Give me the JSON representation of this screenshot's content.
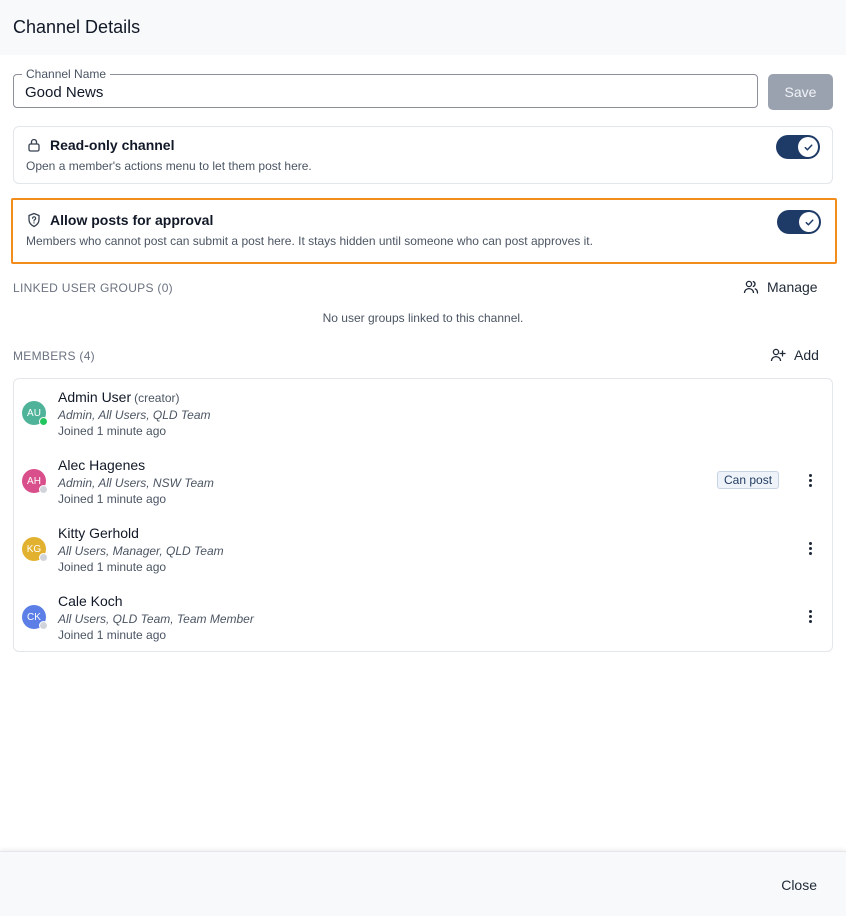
{
  "dialog": {
    "title": "Channel Details"
  },
  "channel_name": {
    "label": "Channel Name",
    "value": "Good News"
  },
  "save_button": {
    "label": "Save"
  },
  "read_only": {
    "title": "Read-only channel",
    "description": "Open a member's actions menu to let them post here.",
    "enabled": true
  },
  "approval": {
    "title": "Allow posts for approval",
    "description": "Members who cannot post can submit a post here. It stays hidden until someone who can post approves it.",
    "enabled": true
  },
  "linked_groups": {
    "label": "LINKED USER GROUPS (0)",
    "action": "Manage",
    "empty": "No user groups linked to this channel."
  },
  "members_section": {
    "label": "MEMBERS (4)",
    "action": "Add",
    "items": [
      {
        "initials": "AU",
        "name": "Admin User",
        "tag": "(creator)",
        "groups": "Admin, All Users, QLD Team",
        "joined": "Joined 1 minute ago",
        "color": "#4fb39a",
        "status": "#22c55e"
      },
      {
        "initials": "AH",
        "name": "Alec Hagenes",
        "groups": "Admin, All Users, NSW Team",
        "joined": "Joined 1 minute ago",
        "color": "#d94f8c",
        "status": "#d1d5db",
        "badge": "Can post"
      },
      {
        "initials": "KG",
        "name": "Kitty Gerhold",
        "groups": "All Users, Manager, QLD Team",
        "joined": "Joined 1 minute ago",
        "color": "#e2b12f",
        "status": "#d1d5db"
      },
      {
        "initials": "CK",
        "name": "Cale Koch",
        "groups": "All Users, QLD Team, Team Member",
        "joined": "Joined 1 minute ago",
        "color": "#5b7fe6",
        "status": "#d1d5db"
      }
    ]
  },
  "footer": {
    "close_label": "Close"
  },
  "colors": {
    "toggle_on": "#1e3a66",
    "highlight": "#f28c1c",
    "save_disabled": "#9aa2b0"
  }
}
